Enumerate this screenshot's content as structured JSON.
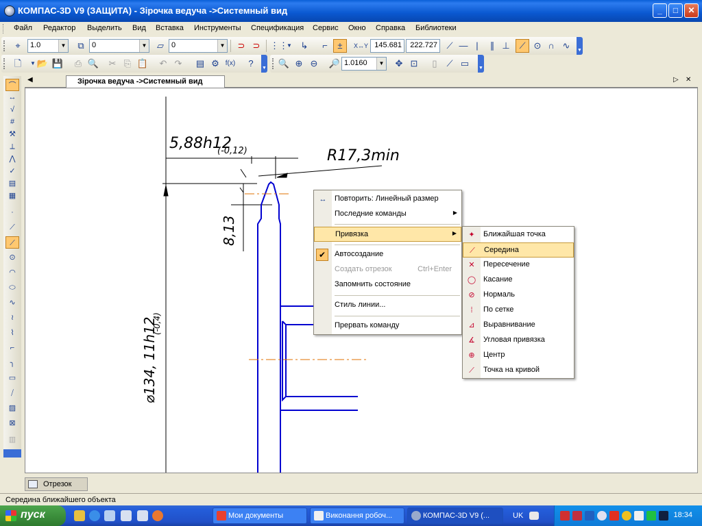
{
  "window": {
    "title": "КОМПАС-3D V9 (ЗАЩИТА) - Зірочка ведуча ->Системный вид"
  },
  "menu": [
    "Файл",
    "Редактор",
    "Выделить",
    "Вид",
    "Вставка",
    "Инструменты",
    "Спецификация",
    "Сервис",
    "Окно",
    "Справка",
    "Библиотеки"
  ],
  "toolbar1": {
    "step": "1.0",
    "layer": "0",
    "style": "0",
    "coord_x": "145.681",
    "coord_y": "222.727"
  },
  "toolbar2": {
    "zoom": "1.0160"
  },
  "document": {
    "tab_title": "Зірочка ведуча ->Системный вид"
  },
  "drawing": {
    "dim_width": "5,88h12",
    "dim_width_tol": "(-0,12)",
    "dim_radius": "R17,3min",
    "dim_height": "8,13",
    "dim_diameter": "⌀134, 11h12",
    "dim_diameter_tol": "(-0,4)"
  },
  "context_menu": {
    "items": [
      {
        "label": "Повторить: Линейный размер",
        "icon": "linear-dimension-icon"
      },
      {
        "label": "Последние команды",
        "submenu": true
      },
      {
        "label": "Привязка",
        "submenu": true,
        "highlighted": true
      },
      {
        "label": "Автосоздание",
        "checked": true
      },
      {
        "label": "Создать отрезок",
        "shortcut": "Ctrl+Enter",
        "disabled": true
      },
      {
        "label": "Запомнить состояние"
      },
      {
        "label": "Стиль линии..."
      },
      {
        "label": "Прервать команду"
      }
    ]
  },
  "snap_submenu": {
    "items": [
      {
        "label": "Ближайшая точка",
        "icon": "nearest-point-icon"
      },
      {
        "label": "Середина",
        "icon": "midpoint-icon",
        "highlighted": true
      },
      {
        "label": "Пересечение",
        "icon": "intersection-icon"
      },
      {
        "label": "Касание",
        "icon": "tangent-icon"
      },
      {
        "label": "Нормаль",
        "icon": "normal-icon"
      },
      {
        "label": "По сетке",
        "icon": "grid-icon"
      },
      {
        "label": "Выравнивание",
        "icon": "alignment-icon"
      },
      {
        "label": "Угловая привязка",
        "icon": "angle-snap-icon"
      },
      {
        "label": "Центр",
        "icon": "center-icon"
      },
      {
        "label": "Точка на кривой",
        "icon": "point-on-curve-icon"
      }
    ]
  },
  "command_panel": {
    "tab": "Отрезок"
  },
  "status": {
    "text": "Середина ближайшего объекта"
  },
  "taskbar": {
    "start": "пуск",
    "tasks": [
      "Мои документы",
      "Виконання робоч...",
      "КОМПАС-3D V9 (..."
    ],
    "language": "UK",
    "clock": "18:34"
  },
  "colors": {
    "drawing_blue": "#0000D0",
    "axis_orange": "#E07000",
    "highlight": "#FFE7A8"
  }
}
